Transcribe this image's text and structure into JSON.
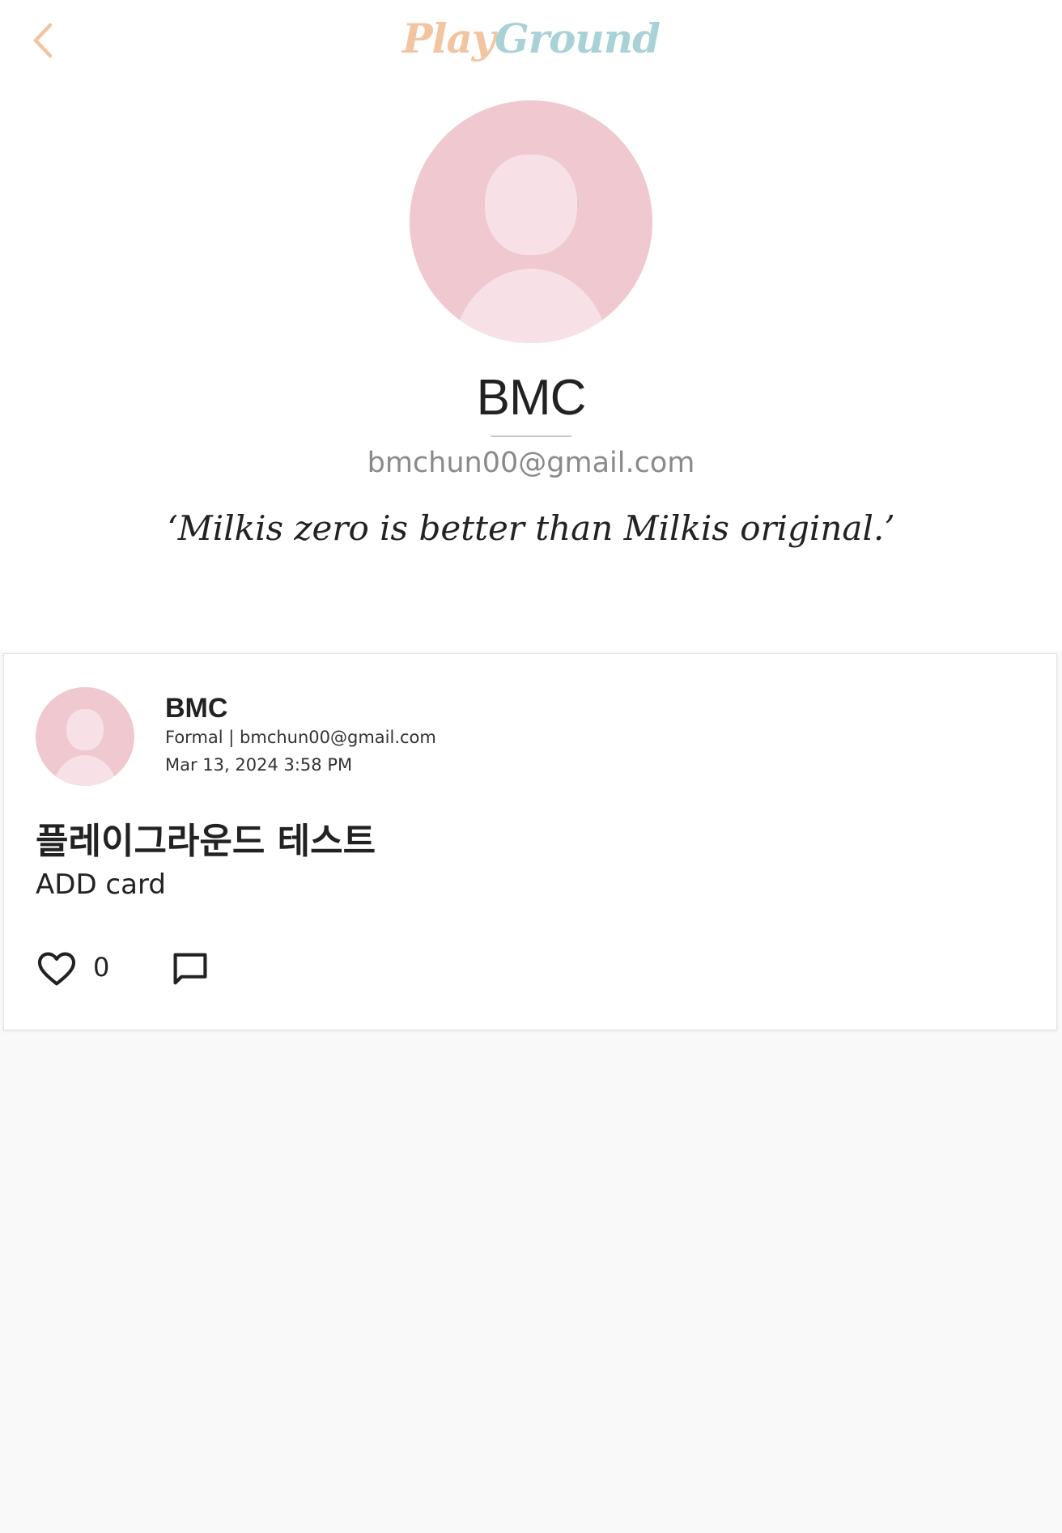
{
  "header": {
    "back_icon": "chevron-left-icon",
    "logo_part1": "Play",
    "logo_part2": "Ground"
  },
  "profile": {
    "avatar_icon": "default-avatar-icon",
    "name": "BMC",
    "email": "bmchun00@gmail.com",
    "quote": "‘Milkis zero is better than Milkis original.’"
  },
  "post": {
    "author": "BMC",
    "meta": "Formal | bmchun00@gmail.com",
    "date": "Mar 13, 2024 3:58 PM",
    "title": "플레이그라운드 테스트",
    "body": "ADD card",
    "like_count": "0",
    "like_icon": "heart-outline-icon",
    "comment_icon": "comment-icon"
  },
  "colors": {
    "accent_orange": "#f2c4a0",
    "accent_teal": "#a9d2d6",
    "avatar_bg": "#efc8d0",
    "avatar_fg": "#f7e1e6",
    "background": "#f9f9f9"
  }
}
